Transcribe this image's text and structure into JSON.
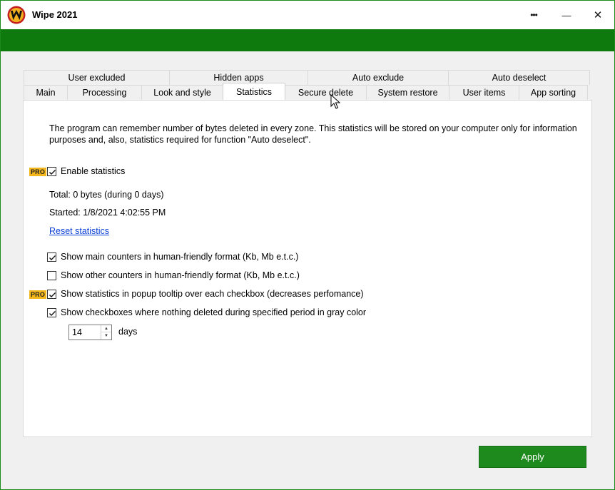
{
  "window": {
    "title": "Wipe 2021",
    "menu_label": "•••",
    "minimize_label": "—",
    "close_label": "✕"
  },
  "tabs": {
    "row1": [
      "User excluded",
      "Hidden apps",
      "Auto exclude",
      "Auto deselect"
    ],
    "row2": [
      "Main",
      "Processing",
      "Look and style",
      "Statistics",
      "Secure delete",
      "System restore",
      "User items",
      "App sorting"
    ],
    "active": "Statistics"
  },
  "statistics": {
    "description": "The program can remember number of bytes deleted in every zone. This statistics will be stored on your computer only for information purposes and, also, statistics required for function \"Auto deselect\".",
    "pro_badge": "PRO",
    "enable_label": "Enable statistics",
    "enable_checked": true,
    "total": "Total: 0 bytes (during 0 days)",
    "started": "Started: 1/8/2021 4:02:55 PM",
    "reset_link": "Reset statistics",
    "options": [
      {
        "label": "Show main counters in human-friendly format (Kb, Mb e.t.c.)",
        "checked": true,
        "pro": false
      },
      {
        "label": "Show other counters in human-friendly format (Kb, Mb e.t.c.)",
        "checked": false,
        "pro": false
      },
      {
        "label": "Show statistics in popup tooltip over each checkbox (decreases perfomance)",
        "checked": true,
        "pro": true
      },
      {
        "label": "Show checkboxes where nothing deleted during specified period in gray color",
        "checked": true,
        "pro": false
      }
    ],
    "days_value": "14",
    "days_unit": "days"
  },
  "footer": {
    "apply_label": "Apply"
  },
  "colors": {
    "brand_green": "#0e7a0e",
    "apply_green": "#1e8a1e",
    "pro_badge": "#f3b61c",
    "link": "#0a3fd6"
  },
  "icons": {
    "app": "wipe-logo-icon",
    "menu": "more-dots-icon",
    "minimize": "minimize-icon",
    "close": "close-icon",
    "check": "checkmark-icon",
    "cursor": "mouse-pointer-icon"
  }
}
